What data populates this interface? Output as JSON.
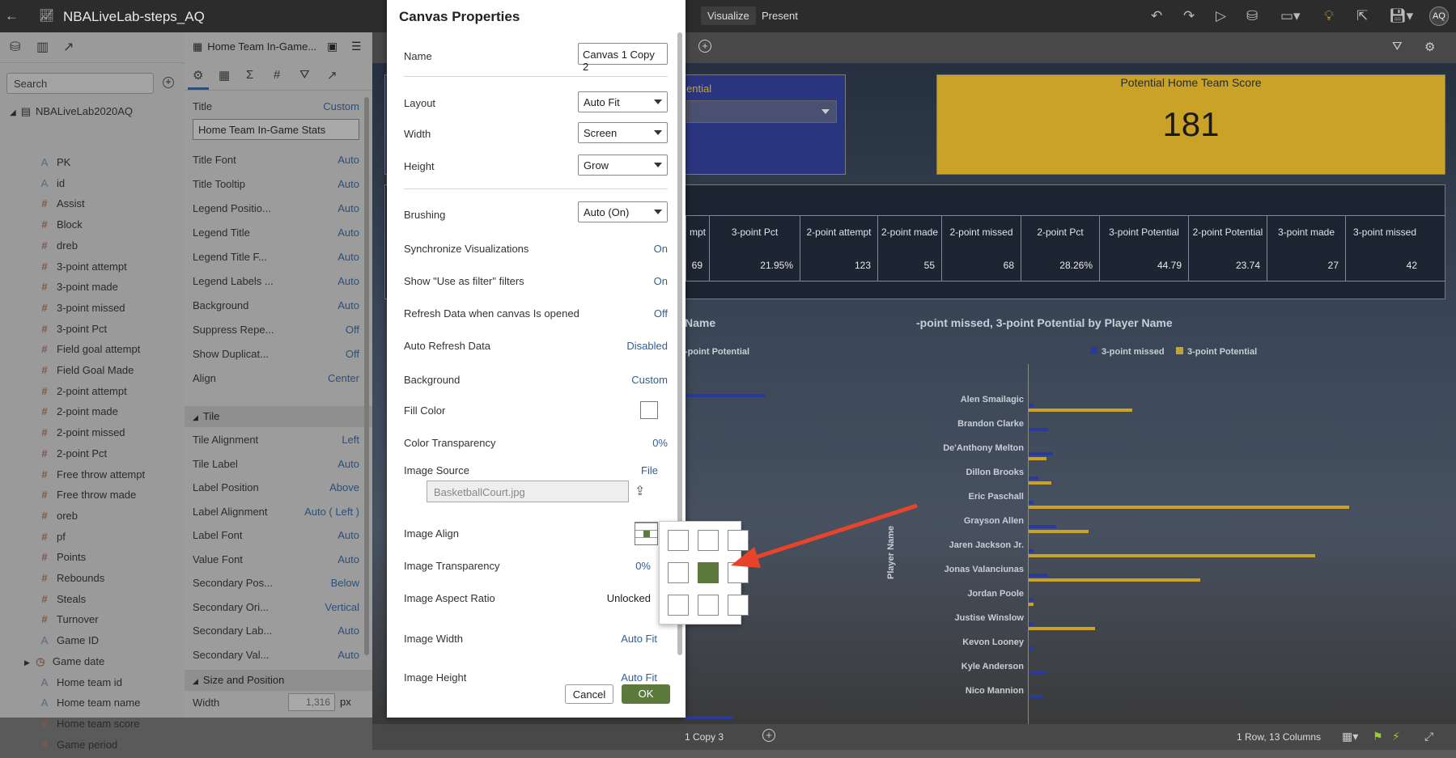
{
  "app": {
    "title": "NBALiveLab-steps_AQ",
    "nav": [
      "a",
      "Visualize",
      "Present"
    ],
    "user": "AQ"
  },
  "data_panel": {
    "search_placeholder": "Search",
    "dataset": "NBALiveLab2020AQ",
    "fields": [
      {
        "t": "A",
        "n": "PK"
      },
      {
        "t": "A",
        "n": "id"
      },
      {
        "t": "#",
        "n": "Assist"
      },
      {
        "t": "#",
        "n": "Block"
      },
      {
        "t": "#",
        "n": "dreb"
      },
      {
        "t": "#",
        "n": "3-point attempt"
      },
      {
        "t": "#",
        "n": "3-point made"
      },
      {
        "t": "#",
        "n": "3-point missed"
      },
      {
        "t": "#",
        "n": "3-point Pct"
      },
      {
        "t": "#",
        "n": "Field goal attempt"
      },
      {
        "t": "#",
        "n": "Field Goal Made"
      },
      {
        "t": "#",
        "n": "2-point attempt"
      },
      {
        "t": "#",
        "n": "2-point made"
      },
      {
        "t": "#",
        "n": "2-point missed"
      },
      {
        "t": "#",
        "n": "2-point Pct"
      },
      {
        "t": "#",
        "n": "Free throw attempt"
      },
      {
        "t": "#",
        "n": "Free throw made"
      },
      {
        "t": "#",
        "n": "oreb"
      },
      {
        "t": "#",
        "n": "pf"
      },
      {
        "t": "#",
        "n": "Points"
      },
      {
        "t": "#",
        "n": "Rebounds"
      },
      {
        "t": "#",
        "n": "Steals"
      },
      {
        "t": "#",
        "n": "Turnover"
      },
      {
        "t": "A",
        "n": "Game ID"
      },
      {
        "t": "◷",
        "n": "Game date"
      },
      {
        "t": "A",
        "n": "Home team id"
      },
      {
        "t": "A",
        "n": "Home team name"
      },
      {
        "t": "#",
        "n": "Home team score"
      },
      {
        "t": "#",
        "n": "Game period"
      }
    ]
  },
  "prop_panel": {
    "header": "Home Team In-Game...",
    "title_label": "Title",
    "title_mode": "Custom",
    "title_value": "Home Team In-Game Stats",
    "rows": [
      {
        "l": "Title Font",
        "v": "Auto"
      },
      {
        "l": "Title Tooltip",
        "v": "Auto"
      },
      {
        "l": "Legend Positio...",
        "v": "Auto"
      },
      {
        "l": "Legend Title",
        "v": "Auto"
      },
      {
        "l": "Legend Title F...",
        "v": "Auto"
      },
      {
        "l": "Legend Labels ...",
        "v": "Auto"
      },
      {
        "l": "Background",
        "v": "Auto"
      },
      {
        "l": "Suppress Repe...",
        "v": "Off"
      },
      {
        "l": "Show Duplicat...",
        "v": "Off"
      },
      {
        "l": "Align",
        "v": "Center"
      }
    ],
    "tile_section": "Tile",
    "tile_rows": [
      {
        "l": "Tile Alignment",
        "v": "Left"
      },
      {
        "l": "Tile Label",
        "v": "Auto"
      },
      {
        "l": "Label Position",
        "v": "Above"
      },
      {
        "l": "Label Alignment",
        "v": "Auto ( Left )"
      },
      {
        "l": "Label Font",
        "v": "Auto"
      },
      {
        "l": "Value Font",
        "v": "Auto"
      },
      {
        "l": "Secondary Pos...",
        "v": "Below"
      },
      {
        "l": "Secondary Ori...",
        "v": "Vertical"
      },
      {
        "l": "Secondary Lab...",
        "v": "Auto"
      },
      {
        "l": "Secondary Val...",
        "v": "Auto"
      }
    ],
    "size_section": "Size and Position",
    "width_label": "Width",
    "width_value": "1,316",
    "width_unit": "px"
  },
  "dialog": {
    "title": "Canvas Properties",
    "name_label": "Name",
    "name_value": "Canvas 1 Copy 2",
    "layout_label": "Layout",
    "layout_value": "Auto Fit",
    "width_label": "Width",
    "width_value": "Screen",
    "height_label": "Height",
    "height_value": "Grow",
    "brushing_label": "Brushing",
    "brushing_value": "Auto (On)",
    "rows": [
      {
        "l": "Synchronize Visualizations",
        "v": "On"
      },
      {
        "l": "Show \"Use as filter\" filters",
        "v": "On"
      },
      {
        "l": "Refresh Data when canvas Is opened",
        "v": "Off"
      },
      {
        "l": "Auto Refresh Data",
        "v": "Disabled"
      },
      {
        "l": "Background",
        "v": "Custom"
      }
    ],
    "fill_color_label": "Fill Color",
    "color_transparency_label": "Color Transparency",
    "color_transparency_value": "0%",
    "image_source_label": "Image Source",
    "image_source_value": "File",
    "file_name": "BasketballCourt.jpg",
    "image_align_label": "Image Align",
    "image_transparency_label": "Image Transparency",
    "image_transparency_value": "0%",
    "image_aspect_label": "Image Aspect Ratio",
    "image_aspect_value": "Unlocked",
    "image_width_label": "Image Width",
    "image_width_value": "Auto Fit",
    "image_height_label": "Image Height",
    "image_height_value": "Auto Fit",
    "cancel": "Cancel",
    "ok": "OK"
  },
  "canvas": {
    "potential_label": "ential",
    "kpi_title": "Potential Home Team Score",
    "kpi_value": "181",
    "table_headers": [
      "mpt",
      "3-point Pct",
      "2-point attempt",
      "2-point made",
      "2-point missed",
      "2-point Pct",
      "3-point Potential",
      "2-point Potential",
      "3-point made",
      "3-point missed"
    ],
    "table_values": [
      "69",
      "21.95%",
      "123",
      "55",
      "68",
      "28.26%",
      "44.79",
      "23.74",
      "27",
      "42"
    ],
    "left_chart_title": "Name",
    "left_legend": "-point Potential",
    "chart_title": "-point missed, 3-point Potential by Player Name",
    "legend_missed": "3-point missed",
    "legend_potential": "3-point Potential",
    "axis_label": "Player Name",
    "players": [
      "Alen Smailagic",
      "Brandon Clarke",
      "De'Anthony Melton",
      "Dillon Brooks",
      "Eric Paschall",
      "Grayson Allen",
      "Jaren Jackson Jr.",
      "Jonas Valanciunas",
      "Jordan Poole",
      "Justise Winslow",
      "Kevon Looney",
      "Kyle Anderson",
      "Nico Mannion"
    ],
    "tab_label": "1 Copy 3",
    "status": "1 Row, 13 Columns"
  },
  "colors": {
    "accent": "#5b7a3c",
    "ok_button": "#5b7a3c",
    "missed": "#2a3a9a",
    "potential": "#c9a227"
  }
}
